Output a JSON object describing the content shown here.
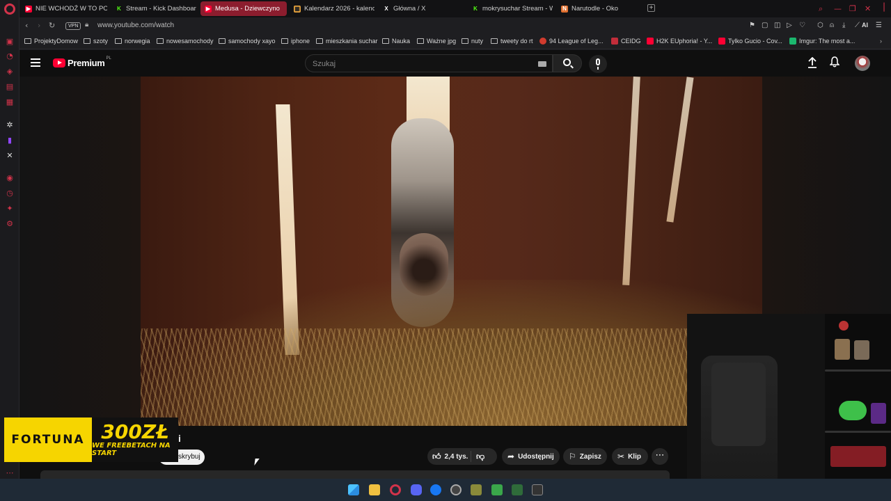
{
  "tabs": [
    {
      "title": "NIE WCHODŹ W TO PO 3(",
      "favicon": "youtube-icon",
      "color": "#ff0033",
      "active": false
    },
    {
      "title": "Stream - Kick Dashboard",
      "favicon": "kick-icon",
      "color": "#53fc18",
      "active": false
    },
    {
      "title": "Medusa - Dziewczyno",
      "favicon": "youtube-icon",
      "color": "#ff0033",
      "active": true
    },
    {
      "title": "Kalendarz 2026 - kalenda",
      "favicon": "calendar-icon",
      "color": "#e6a23c",
      "active": false
    },
    {
      "title": "Główna / X",
      "favicon": "x-icon",
      "color": "#ffffff",
      "active": false
    },
    {
      "title": "mokrysuchar Stream - Wa",
      "favicon": "kick-icon",
      "color": "#53fc18",
      "active": false
    },
    {
      "title": "Narutodle - Oko",
      "favicon": "narutodle-icon",
      "color": "#e07030",
      "active": false
    }
  ],
  "address": {
    "vpn": "VPN",
    "url": "www.youtube.com/watch",
    "ai": "AI"
  },
  "bookmarks": [
    {
      "label": "ProjektyDomow",
      "type": "folder"
    },
    {
      "label": "szoty",
      "type": "folder"
    },
    {
      "label": "norwegia",
      "type": "folder"
    },
    {
      "label": "nowesamochody",
      "type": "folder"
    },
    {
      "label": "samochody xayo",
      "type": "folder"
    },
    {
      "label": "iphone",
      "type": "folder"
    },
    {
      "label": "mieszkania suchar",
      "type": "folder"
    },
    {
      "label": "Nauka",
      "type": "folder"
    },
    {
      "label": "Ważne jpg",
      "type": "folder"
    },
    {
      "label": "nuty",
      "type": "folder"
    },
    {
      "label": "tweety do rt",
      "type": "folder"
    },
    {
      "label": "94 League of Leg...",
      "type": "site",
      "color": "#d13b2e"
    },
    {
      "label": "CEIDG",
      "type": "site",
      "color": "#c22d3a"
    },
    {
      "label": "H2K EUphoria! - Y...",
      "type": "site",
      "color": "#ff0033"
    },
    {
      "label": "Tylko Gucio - Cov...",
      "type": "site",
      "color": "#ff0033"
    },
    {
      "label": "Imgur: The most a...",
      "type": "site",
      "color": "#1bb76e"
    }
  ],
  "youtube": {
    "logo_text": "Premium",
    "region": "PL",
    "search_placeholder": "Szukaj",
    "video_title_fragment": "i",
    "subscribe_label": "skrybuj",
    "actions": {
      "likes": "2,4 tys.",
      "share": "Udostępnij",
      "save": "Zapisz",
      "clip": "Klip"
    }
  },
  "ad": {
    "brand": "FORTUNA",
    "amount": "300ZŁ",
    "tagline": "WE FREEBETACH NA START",
    "colors": {
      "yellow": "#f6d500",
      "dark": "#111111"
    }
  },
  "colors": {
    "opera_red": "#d2334a",
    "yt_bg": "#0f0f0f",
    "taskbar": "#1f2a36"
  }
}
